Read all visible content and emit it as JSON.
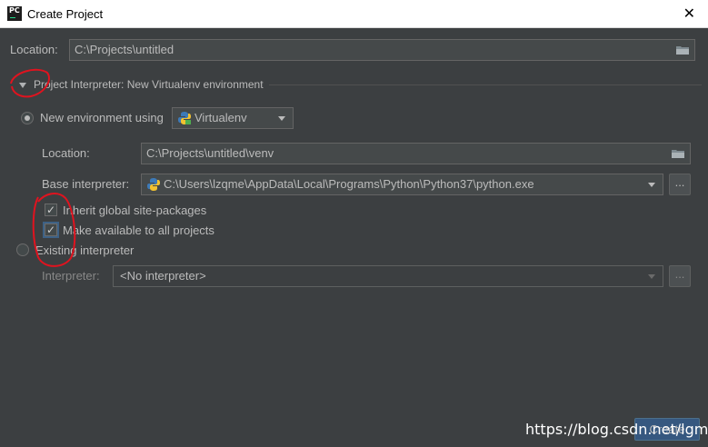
{
  "window": {
    "title": "Create Project",
    "app_icon_text": "PC",
    "close_glyph": "✕"
  },
  "location": {
    "label": "Location:",
    "value": "C:\\Projects\\untitled"
  },
  "interpreter_section": {
    "title": "Project Interpreter: New Virtualenv environment",
    "expanded": true
  },
  "new_env": {
    "radio_label": "New environment using",
    "selected": true,
    "tool": "Virtualenv",
    "location_label": "Location:",
    "location_value": "C:\\Projects\\untitled\\venv",
    "base_label": "Base interpreter:",
    "base_value": "C:\\Users\\lzqme\\AppData\\Local\\Programs\\Python\\Python37\\python.exe",
    "inherit_label": "Inherit global site-packages",
    "inherit_checked": true,
    "make_available_label": "Make available to all projects",
    "make_available_checked": true
  },
  "existing": {
    "radio_label": "Existing interpreter",
    "selected": false,
    "interpreter_label": "Interpreter:",
    "interpreter_value": "<No interpreter>"
  },
  "buttons": {
    "browse": "...",
    "create": "Create"
  },
  "watermark": "https://blog.csdn.net/lgmall",
  "icons": {
    "folder": "folder-icon",
    "python": "python-icon",
    "check": "✓",
    "annotation_color": "#e0131f"
  }
}
